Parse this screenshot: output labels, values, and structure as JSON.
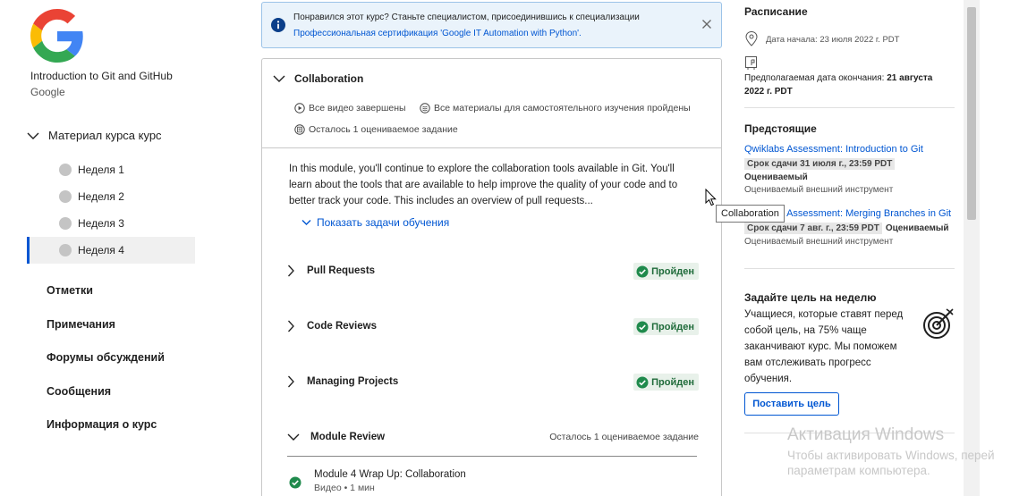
{
  "sidebar": {
    "course_title": "Introduction to Git and GitHub",
    "course_org": "Google",
    "material_label": "Материал курса курс",
    "weeks": [
      {
        "label": "Неделя 1"
      },
      {
        "label": "Неделя 2"
      },
      {
        "label": "Неделя 3"
      },
      {
        "label": "Неделя 4"
      }
    ],
    "active_week": 4,
    "links": [
      "Отметки",
      "Примечания",
      "Форумы обсуждений",
      "Сообщения",
      "Информация о курс"
    ]
  },
  "banner": {
    "text": "Понравился этот курс? Станьте специалистом, присоединившись к специализации",
    "link": "Профессиональная сертификация 'Google IT Automation with Python'."
  },
  "module": {
    "title": "Collaboration",
    "meta_videos": "Все видео завершены",
    "meta_materials": "Все материалы для самостоятельного изучения пройдены",
    "meta_remaining": "Осталось 1 оцениваемое задание",
    "description": "In this module, you'll continue to explore the collaboration tools available in Git. You'll learn about the tools that are available to help improve the quality of your code and to better track your code. This includes an overview of pull requests...",
    "show_tasks": "Показать задачи обучения",
    "lessons": [
      {
        "name": "Pull Requests",
        "status": "Пройден"
      },
      {
        "name": "Code Reviews",
        "status": "Пройден"
      },
      {
        "name": "Managing Projects",
        "status": "Пройден"
      }
    ],
    "review": {
      "name": "Module Review",
      "remaining": "Осталось 1 оцениваемое задание"
    },
    "wrap_item": {
      "title": "Module 4 Wrap Up: Collaboration",
      "sub": "Видео • 1 мин"
    }
  },
  "tooltip": "Collaboration",
  "right": {
    "schedule_title": "Расписание",
    "start_date": "Дата начала: 23 июля 2022 г. PDT",
    "end_label": "Предполагаемая дата окончания: ",
    "end_date": "21 августа 2022 г. PDT",
    "upcoming_title": "Предстоящие",
    "upcoming": [
      {
        "link": "Qwiklabs Assessment: Introduction to Git",
        "deadline": "Срок сдачи 31 июля г., 23:59 PDT",
        "graded": "Оцениваемый",
        "sub": "Оцениваемый внешний инструмент"
      },
      {
        "link": "Qwiklabs Assessment: Merging Branches in Git",
        "deadline": "Срок сдачи 7 авг. г., 23:59 PDT",
        "graded": "Оцениваемый",
        "sub": "Оцениваемый внешний инструмент"
      }
    ],
    "goal_title": "Задайте цель на неделю",
    "goal_text": "Учащиеся, которые ставят перед собой цель, на 75% чаще заканчивают курс. Мы поможем вам отслеживать прогресс обучения.",
    "goal_button": "Поставить цель"
  },
  "watermark": {
    "line1": "Активация Windows",
    "line2": "Чтобы активировать Windows, перей",
    "line3": "параметрам компьютера."
  },
  "colors": {
    "accent": "#0056d2",
    "success": "#1f6b3a",
    "success_bg": "#e8f1ea",
    "banner_bg": "#eaf3fb"
  }
}
